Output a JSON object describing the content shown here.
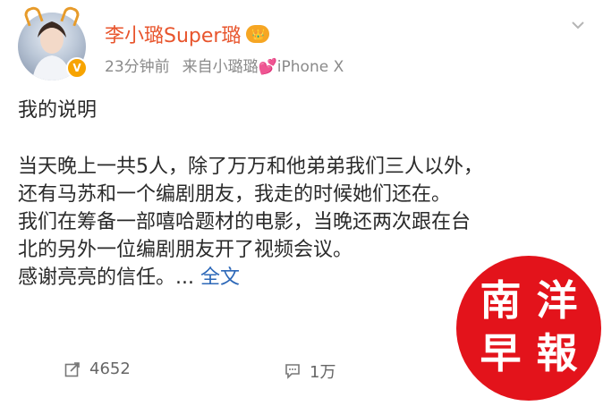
{
  "post": {
    "username": "李小璐Super璐",
    "vip_badge": "👑",
    "time": "23分钟前",
    "source": "来自小璐璐💕iPhone X",
    "body": {
      "line1": "我的说明",
      "line2": "当天晚上一共5人，除了万万和他弟弟我们三人以外，",
      "line3": "还有马苏和一个编剧朋友，我走的时候她们还在。",
      "line4": "我们在筹备一部嘻哈题材的电影，当晚还两次跟在台",
      "line5": "北的另外一位编剧朋友开了视频会议。",
      "line6": "感谢亮亮的信任。... ",
      "full_text_link": "全文"
    },
    "actions": {
      "share_count": "4652",
      "comment_count": "1万"
    }
  },
  "watermark": {
    "chars": [
      "南",
      "洋",
      "早",
      "報"
    ],
    "color": "#e3131b"
  },
  "colors": {
    "username": "#e8552d",
    "link": "#2d68b8",
    "meta": "#8a8a8a"
  }
}
